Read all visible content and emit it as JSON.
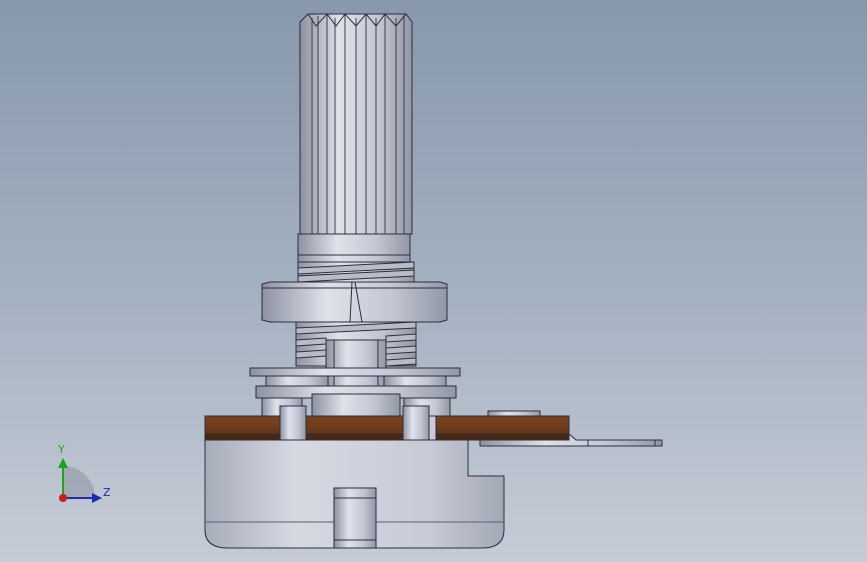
{
  "viewport": {
    "background_top": "#8798ac",
    "background_bottom": "#c6ccd6"
  },
  "model": {
    "parts": [
      "knurled-shaft",
      "shaft-collar",
      "threaded-bushing",
      "hex-nut",
      "washer",
      "phenolic-wafer",
      "metal-housing",
      "solder-terminal"
    ],
    "colors": {
      "metal": "#c9ccd8",
      "metal_dark": "#8d92a2",
      "edge": "#2b2f3a",
      "phenolic": "#6e3d1b",
      "phenolic_dark": "#4a2810"
    }
  },
  "triad": {
    "y_label": "Y",
    "z_label": "Z",
    "y_color": "#16a81a",
    "z_color": "#1a2db0",
    "x_color": "#d21a1a"
  }
}
